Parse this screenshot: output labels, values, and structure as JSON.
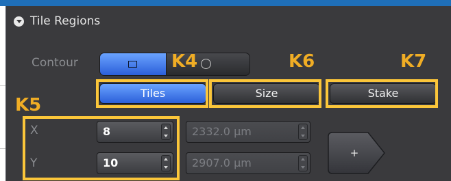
{
  "panel": {
    "title": "Tile Regions",
    "contour_label": "Contour",
    "contour_mode": "rectangle",
    "mode_tabs": [
      {
        "label": "Tiles",
        "active": true
      },
      {
        "label": "Size",
        "active": false
      },
      {
        "label": "Stake",
        "active": false
      }
    ],
    "x": {
      "label": "X",
      "value": "8",
      "size": "2332.0 µm"
    },
    "y": {
      "label": "Y",
      "value": "10",
      "size": "2907.0 µm"
    },
    "add_label": "+"
  },
  "annotations": {
    "k4": "K4",
    "k5": "K5",
    "k6": "K6",
    "k7": "K7"
  },
  "colors": {
    "accent": "#3f7ef0",
    "highlight": "#fbc63a",
    "annotation_text": "#f0ad25",
    "panel_bg": "#3a3a3d",
    "topbar": "#1f6fb9"
  }
}
